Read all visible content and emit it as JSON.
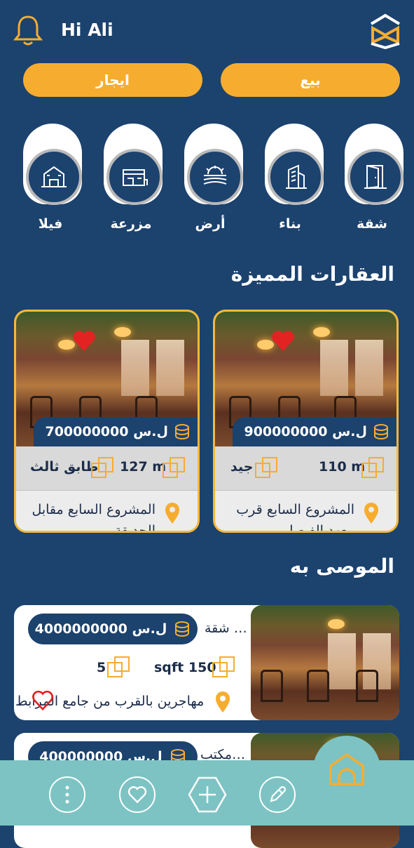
{
  "header": {
    "greeting": "Hi Ali"
  },
  "mode_buttons": {
    "rent": "ايجار",
    "sell": "بيع"
  },
  "categories": [
    {
      "label": "فيلا",
      "icon": "villa-icon"
    },
    {
      "label": "مزرعة",
      "icon": "farm-icon"
    },
    {
      "label": "أرض",
      "icon": "land-icon"
    },
    {
      "label": "بناء",
      "icon": "building-icon"
    },
    {
      "label": "شقة",
      "icon": "apartment-icon"
    }
  ],
  "featured": {
    "title": "العقارات المميزة",
    "cards": [
      {
        "price": "700000000 ل.س",
        "area": "127 m",
        "detail": "طابق ثالث",
        "location": "المشروع السابع مقابل الحديقة"
      },
      {
        "price": "900000000 ل.س",
        "area": "110 m",
        "detail": "جيد",
        "location": "المشروع السابع قرب معهد الفيصل"
      }
    ]
  },
  "recommended": {
    "title": "الموصى به",
    "items": [
      {
        "name": "شقة …",
        "price": "4000000000 ل.س",
        "rooms": "5",
        "area": "sqft 150",
        "location": "مهاجرين  بالقرب من جامع المرابط"
      },
      {
        "name": "مكتب…",
        "price": "400000000 ل.س"
      }
    ]
  },
  "colors": {
    "accent": "#f6ad2f",
    "background": "#1c426e",
    "nav": "#7dc3c4"
  }
}
